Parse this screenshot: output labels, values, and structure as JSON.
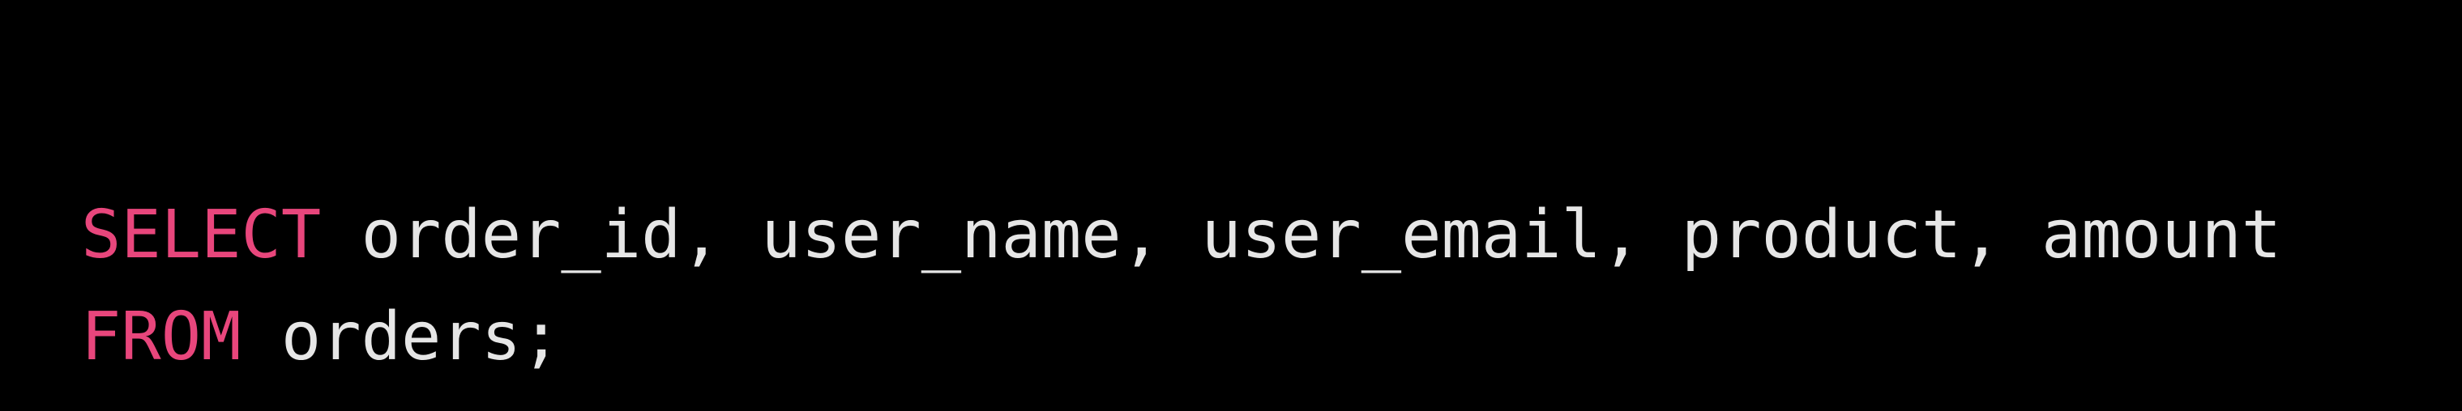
{
  "colors": {
    "background": "#000000",
    "keyword": "#e8467c",
    "text": "#e6e6e6"
  },
  "code": {
    "lines": [
      {
        "keyword": "SELECT",
        "rest": " order_id, user_name, user_email, product, amount"
      },
      {
        "keyword": "FROM",
        "rest": " orders;"
      }
    ]
  }
}
